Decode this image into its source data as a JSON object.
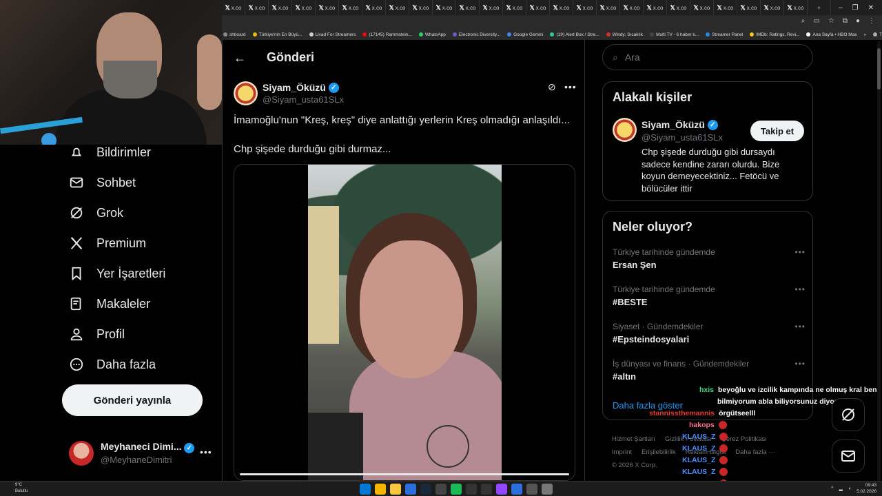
{
  "browser": {
    "tab_label": "x.co",
    "tab_count": 25,
    "bookmarks": [
      {
        "label": "shboard",
        "color": "#888888"
      },
      {
        "label": "Türkiye'nin En Büyü...",
        "color": "#f5b400"
      },
      {
        "label": "Livad For Streamers",
        "color": "#cccccc"
      },
      {
        "label": "(17145) Rammstein...",
        "color": "#ff0000"
      },
      {
        "label": "WhatsApp",
        "color": "#25d366"
      },
      {
        "label": "Electronic Diversity...",
        "color": "#6a5acd"
      },
      {
        "label": "Google Gemini",
        "color": "#4285f4"
      },
      {
        "label": "(19) Alert Box / Stre...",
        "color": "#31c3a2"
      },
      {
        "label": "Windy: Sıcaklık",
        "color": "#d32f2f"
      },
      {
        "label": "Multi TV - 6 haber k...",
        "color": "#444444"
      },
      {
        "label": "Streamer Panel",
        "color": "#1e88e5"
      },
      {
        "label": "IMDb: Ratings, Revi...",
        "color": "#f5c518"
      },
      {
        "label": "Ana Sayfa • HBO Max",
        "color": "#ffffff"
      },
      {
        "label": "»",
        "color": ""
      },
      {
        "label": "Tüm Yer İşaretleri",
        "color": "#aaaaaa"
      }
    ]
  },
  "sidebar": {
    "items": [
      {
        "label": "Bildirimler",
        "icon": "bell-icon"
      },
      {
        "label": "Sohbet",
        "icon": "mail-icon"
      },
      {
        "label": "Grok",
        "icon": "grok-icon"
      },
      {
        "label": "Premium",
        "icon": "x-icon"
      },
      {
        "label": "Yer İşaretleri",
        "icon": "bookmark-icon"
      },
      {
        "label": "Makaleler",
        "icon": "article-icon"
      },
      {
        "label": "Profil",
        "icon": "person-icon"
      },
      {
        "label": "Daha fazla",
        "icon": "more-circle-icon"
      }
    ],
    "post_button": "Gönderi yayınla",
    "profile": {
      "name": "Meyhaneci Dimi...",
      "handle": "@MeyhaneDimitri"
    }
  },
  "main": {
    "title": "Gönderi",
    "post": {
      "author": "Siyam_Öküzü",
      "handle": "@Siyam_usta61SLx",
      "text_line1": "İmamoğlu'nun  \"Kreş, kreş\" diye anlattığı yerlerin Kreş olmadığı anlaşıldı...",
      "text_line2": "Chp şişede durduğu gibi durmaz...",
      "video_progress": 1.0
    }
  },
  "right": {
    "search_placeholder": "Ara",
    "related": {
      "title": "Alakalı kişiler",
      "name": "Siyam_Öküzü",
      "handle": "@Siyam_usta61SLx",
      "follow_label": "Takip et",
      "bio": "Chp şişede durduğu gibi dursaydı sadece kendine zararı olurdu. Bize koyun demeyecektiniz... Fetöcü ve bölücüler ittir"
    },
    "trends": {
      "title": "Neler oluyor?",
      "items": [
        {
          "context": "Türkiye tarihinde gündemde",
          "topic": "Ersan Şen"
        },
        {
          "context": "Türkiye tarihinde gündemde",
          "topic": "#BESTE"
        },
        {
          "context": "Siyaset · Gündemdekiler",
          "topic": "#Epsteindosyalari"
        },
        {
          "context": "İş dünyası ve finans · Gündemdekiler",
          "topic": "#altın"
        }
      ],
      "show_more": "Daha fazla göster"
    },
    "footer": {
      "row1": [
        "Hizmet Şartları",
        "Gizlilik Politikası",
        "Çerez Politikası"
      ],
      "row2": [
        "Imprint",
        "Erişilebilirlik",
        "Reklam bilgisi",
        "Daha fazla ···"
      ],
      "row3": [
        "© 2026 X Corp."
      ]
    }
  },
  "chat": {
    "messages": [
      {
        "user": "hxis",
        "color": "#3ddc84",
        "text": "beyoğlu ve izcilik kampında ne olmuş kral ben"
      },
      {
        "user": "",
        "color": "#ffffff",
        "text": "bilmiyorum abla biliyorsunuz diyor ama"
      },
      {
        "user": "stannissthemannis",
        "color": "#e53935",
        "text": "örgütseelll"
      },
      {
        "user": "hakops",
        "color": "#ff6f91",
        "text": ""
      },
      {
        "user": "KLAUS_Z",
        "color": "#4a90ff",
        "text": ""
      },
      {
        "user": "KLAUS_Z",
        "color": "#4a90ff",
        "text": ""
      },
      {
        "user": "KLAUS_Z",
        "color": "#4a90ff",
        "text": ""
      },
      {
        "user": "KLAUS_Z",
        "color": "#4a90ff",
        "text": ""
      },
      {
        "user": "KLAUS_Z",
        "color": "#4a90ff",
        "text": ""
      }
    ]
  },
  "taskbar": {
    "weather_temp": "9°C",
    "weather_text": "Bulutlu",
    "time": "09:43",
    "date": "5.02.2026"
  }
}
